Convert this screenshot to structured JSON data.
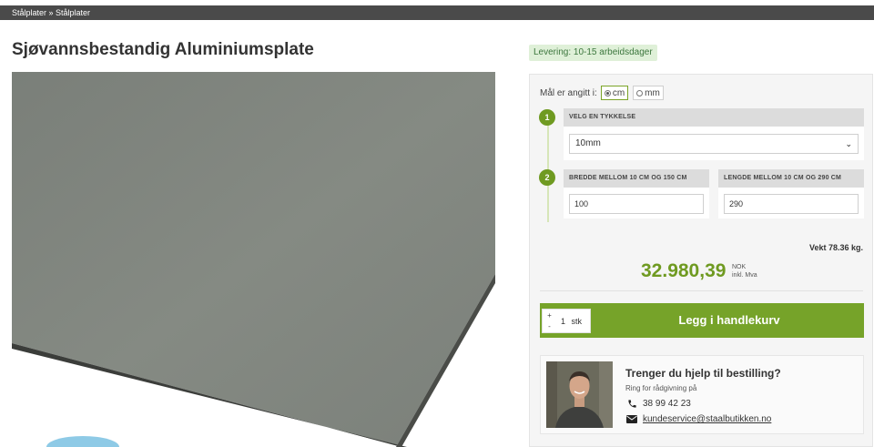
{
  "breadcrumb": "Stålplater » Stålplater",
  "product": {
    "title": "Sjøvannsbestandig Aluminiumsplate",
    "delivery": "Levering: 10-15 arbeidsdager"
  },
  "configurator": {
    "units_label": "Mål er angitt i:",
    "units": [
      {
        "label": "cm",
        "selected": true
      },
      {
        "label": "mm",
        "selected": false
      }
    ],
    "steps": [
      {
        "number": "1",
        "header": "VELG EN TYKKELSE",
        "select_value": "10mm"
      },
      {
        "number": "2",
        "width_header": "BREDDE MELLOM 10 CM OG 150 CM",
        "width_value": "100",
        "length_header": "LENGDE MELLOM 10 CM OG 290 CM",
        "length_value": "290"
      }
    ]
  },
  "weight": "Vekt 78.36 kg.",
  "price": {
    "amount": "32.980,39",
    "currency": "NOK",
    "vat_note": "inkl. Mva"
  },
  "cart": {
    "plus": "+",
    "minus": "-",
    "quantity": "1",
    "unit": "stk",
    "add_label": "Legg i handlekurv"
  },
  "help": {
    "title": "Trenger du hjelp til bestilling?",
    "subtitle": "Ring for rådgivning på",
    "phone": "38 99 42 23",
    "email": "kundeservice@staalbutikken.no"
  },
  "colors": {
    "accent": "#76a329",
    "price": "#6f9a21",
    "breadcrumb_bg": "#4a4a4a",
    "delivery_bg": "#dff0d8"
  }
}
